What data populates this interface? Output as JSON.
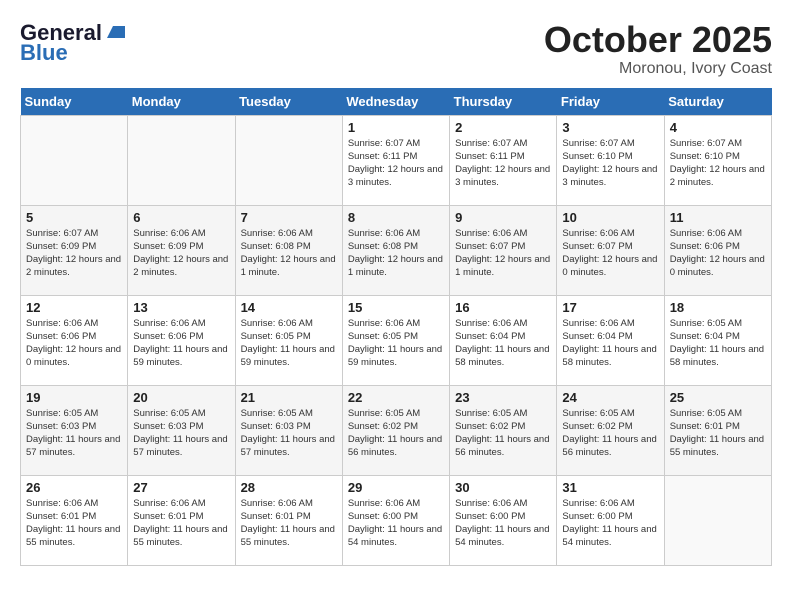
{
  "header": {
    "logo_general": "General",
    "logo_blue": "Blue",
    "month": "October 2025",
    "location": "Moronou, Ivory Coast"
  },
  "weekdays": [
    "Sunday",
    "Monday",
    "Tuesday",
    "Wednesday",
    "Thursday",
    "Friday",
    "Saturday"
  ],
  "weeks": [
    [
      {
        "day": "",
        "info": ""
      },
      {
        "day": "",
        "info": ""
      },
      {
        "day": "",
        "info": ""
      },
      {
        "day": "1",
        "info": "Sunrise: 6:07 AM\nSunset: 6:11 PM\nDaylight: 12 hours and 3 minutes."
      },
      {
        "day": "2",
        "info": "Sunrise: 6:07 AM\nSunset: 6:11 PM\nDaylight: 12 hours and 3 minutes."
      },
      {
        "day": "3",
        "info": "Sunrise: 6:07 AM\nSunset: 6:10 PM\nDaylight: 12 hours and 3 minutes."
      },
      {
        "day": "4",
        "info": "Sunrise: 6:07 AM\nSunset: 6:10 PM\nDaylight: 12 hours and 2 minutes."
      }
    ],
    [
      {
        "day": "5",
        "info": "Sunrise: 6:07 AM\nSunset: 6:09 PM\nDaylight: 12 hours and 2 minutes."
      },
      {
        "day": "6",
        "info": "Sunrise: 6:06 AM\nSunset: 6:09 PM\nDaylight: 12 hours and 2 minutes."
      },
      {
        "day": "7",
        "info": "Sunrise: 6:06 AM\nSunset: 6:08 PM\nDaylight: 12 hours and 1 minute."
      },
      {
        "day": "8",
        "info": "Sunrise: 6:06 AM\nSunset: 6:08 PM\nDaylight: 12 hours and 1 minute."
      },
      {
        "day": "9",
        "info": "Sunrise: 6:06 AM\nSunset: 6:07 PM\nDaylight: 12 hours and 1 minute."
      },
      {
        "day": "10",
        "info": "Sunrise: 6:06 AM\nSunset: 6:07 PM\nDaylight: 12 hours and 0 minutes."
      },
      {
        "day": "11",
        "info": "Sunrise: 6:06 AM\nSunset: 6:06 PM\nDaylight: 12 hours and 0 minutes."
      }
    ],
    [
      {
        "day": "12",
        "info": "Sunrise: 6:06 AM\nSunset: 6:06 PM\nDaylight: 12 hours and 0 minutes."
      },
      {
        "day": "13",
        "info": "Sunrise: 6:06 AM\nSunset: 6:06 PM\nDaylight: 11 hours and 59 minutes."
      },
      {
        "day": "14",
        "info": "Sunrise: 6:06 AM\nSunset: 6:05 PM\nDaylight: 11 hours and 59 minutes."
      },
      {
        "day": "15",
        "info": "Sunrise: 6:06 AM\nSunset: 6:05 PM\nDaylight: 11 hours and 59 minutes."
      },
      {
        "day": "16",
        "info": "Sunrise: 6:06 AM\nSunset: 6:04 PM\nDaylight: 11 hours and 58 minutes."
      },
      {
        "day": "17",
        "info": "Sunrise: 6:06 AM\nSunset: 6:04 PM\nDaylight: 11 hours and 58 minutes."
      },
      {
        "day": "18",
        "info": "Sunrise: 6:05 AM\nSunset: 6:04 PM\nDaylight: 11 hours and 58 minutes."
      }
    ],
    [
      {
        "day": "19",
        "info": "Sunrise: 6:05 AM\nSunset: 6:03 PM\nDaylight: 11 hours and 57 minutes."
      },
      {
        "day": "20",
        "info": "Sunrise: 6:05 AM\nSunset: 6:03 PM\nDaylight: 11 hours and 57 minutes."
      },
      {
        "day": "21",
        "info": "Sunrise: 6:05 AM\nSunset: 6:03 PM\nDaylight: 11 hours and 57 minutes."
      },
      {
        "day": "22",
        "info": "Sunrise: 6:05 AM\nSunset: 6:02 PM\nDaylight: 11 hours and 56 minutes."
      },
      {
        "day": "23",
        "info": "Sunrise: 6:05 AM\nSunset: 6:02 PM\nDaylight: 11 hours and 56 minutes."
      },
      {
        "day": "24",
        "info": "Sunrise: 6:05 AM\nSunset: 6:02 PM\nDaylight: 11 hours and 56 minutes."
      },
      {
        "day": "25",
        "info": "Sunrise: 6:05 AM\nSunset: 6:01 PM\nDaylight: 11 hours and 55 minutes."
      }
    ],
    [
      {
        "day": "26",
        "info": "Sunrise: 6:06 AM\nSunset: 6:01 PM\nDaylight: 11 hours and 55 minutes."
      },
      {
        "day": "27",
        "info": "Sunrise: 6:06 AM\nSunset: 6:01 PM\nDaylight: 11 hours and 55 minutes."
      },
      {
        "day": "28",
        "info": "Sunrise: 6:06 AM\nSunset: 6:01 PM\nDaylight: 11 hours and 55 minutes."
      },
      {
        "day": "29",
        "info": "Sunrise: 6:06 AM\nSunset: 6:00 PM\nDaylight: 11 hours and 54 minutes."
      },
      {
        "day": "30",
        "info": "Sunrise: 6:06 AM\nSunset: 6:00 PM\nDaylight: 11 hours and 54 minutes."
      },
      {
        "day": "31",
        "info": "Sunrise: 6:06 AM\nSunset: 6:00 PM\nDaylight: 11 hours and 54 minutes."
      },
      {
        "day": "",
        "info": ""
      }
    ]
  ]
}
